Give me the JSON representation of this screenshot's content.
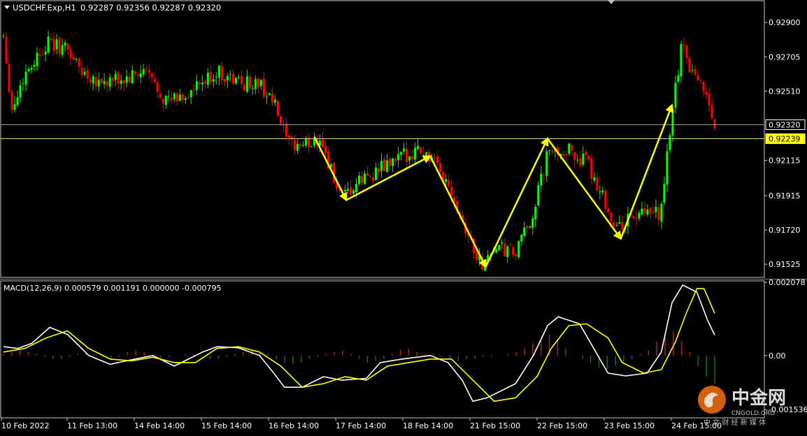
{
  "header": {
    "symbol": "USDCHF.Exp,H1",
    "ohlc": "0.92287 0.92356 0.92287 0.92320"
  },
  "macd": {
    "label": "MACD(12,26,9) 0.000579 0.001191 0.000000 -0.000795"
  },
  "watermark": {
    "brand": "中金网",
    "site": "CNGOLD.ORG",
    "tagline": "中 文 财 经 新 媒 体"
  },
  "colors": {
    "background": "#000000",
    "bull_candle": "#00ff00",
    "bear_candle": "#ff0000",
    "macd_line": "#ffffff",
    "signal_line": "#ffff00",
    "arrows": "#ffff00",
    "hist_positive": "#b02020",
    "hist_negative": "#1f6a1f",
    "current_price_tag": "#ffff00"
  },
  "chart_data": [
    {
      "type": "candlestick",
      "title": "USDCHF.Exp,H1",
      "y_ticks": [
        "0.92900",
        "0.92705",
        "0.92510",
        "0.92320",
        "0.92239",
        "0.92115",
        "0.91915",
        "0.91720",
        "0.91525"
      ],
      "ylim": [
        0.9145,
        0.9302
      ],
      "price_lines": [
        {
          "label": "0.92320",
          "value": 0.9232,
          "tag": "white"
        },
        {
          "label": "0.92239",
          "value": 0.92239,
          "tag": "yellow"
        }
      ],
      "x_ticks": [
        "10 Feb 2022",
        "11 Feb 13:00",
        "14 Feb 14:00",
        "15 Feb 14:00",
        "16 Feb 14:00",
        "17 Feb 14:00",
        "18 Feb 14:00",
        "21 Feb 15:00",
        "22 Feb 15:00",
        "23 Feb 15:00",
        "24 Feb 15:00"
      ],
      "close_path": [
        {
          "t": 0.0,
          "p": 0.9283
        },
        {
          "t": 0.012,
          "p": 0.924
        },
        {
          "t": 0.03,
          "p": 0.9261
        },
        {
          "t": 0.06,
          "p": 0.9278
        },
        {
          "t": 0.09,
          "p": 0.9275
        },
        {
          "t": 0.11,
          "p": 0.9262
        },
        {
          "t": 0.14,
          "p": 0.9256
        },
        {
          "t": 0.17,
          "p": 0.9257
        },
        {
          "t": 0.2,
          "p": 0.9262
        },
        {
          "t": 0.23,
          "p": 0.9245
        },
        {
          "t": 0.26,
          "p": 0.9249
        },
        {
          "t": 0.28,
          "p": 0.9255
        },
        {
          "t": 0.3,
          "p": 0.9262
        },
        {
          "t": 0.33,
          "p": 0.9256
        },
        {
          "t": 0.36,
          "p": 0.9255
        },
        {
          "t": 0.38,
          "p": 0.9244
        },
        {
          "t": 0.4,
          "p": 0.922
        },
        {
          "t": 0.43,
          "p": 0.9221
        },
        {
          "t": 0.445,
          "p": 0.9225
        },
        {
          "t": 0.475,
          "p": 0.9188
        },
        {
          "t": 0.505,
          "p": 0.9201
        },
        {
          "t": 0.55,
          "p": 0.9211
        },
        {
          "t": 0.585,
          "p": 0.9219
        },
        {
          "t": 0.605,
          "p": 0.921
        },
        {
          "t": 0.63,
          "p": 0.9195
        },
        {
          "t": 0.66,
          "p": 0.9162
        },
        {
          "t": 0.672,
          "p": 0.9152
        },
        {
          "t": 0.69,
          "p": 0.9162
        },
        {
          "t": 0.72,
          "p": 0.9158
        },
        {
          "t": 0.745,
          "p": 0.9182
        },
        {
          "t": 0.765,
          "p": 0.9215
        },
        {
          "t": 0.79,
          "p": 0.9218
        },
        {
          "t": 0.82,
          "p": 0.921
        },
        {
          "t": 0.845,
          "p": 0.919
        },
        {
          "t": 0.86,
          "p": 0.9172
        },
        {
          "t": 0.885,
          "p": 0.918
        },
        {
          "t": 0.91,
          "p": 0.918
        },
        {
          "t": 0.925,
          "p": 0.9182
        },
        {
          "t": 0.94,
          "p": 0.924
        },
        {
          "t": 0.955,
          "p": 0.928
        },
        {
          "t": 0.965,
          "p": 0.9265
        },
        {
          "t": 0.985,
          "p": 0.9253
        },
        {
          "t": 1.0,
          "p": 0.9232
        }
      ],
      "annotations": [
        {
          "type": "arrow",
          "from": {
            "t": 0.437,
            "p": 0.9225
          },
          "to": {
            "t": 0.482,
            "p": 0.9189
          }
        },
        {
          "type": "arrow",
          "from": {
            "t": 0.482,
            "p": 0.9189
          },
          "to": {
            "t": 0.6,
            "p": 0.9214
          }
        },
        {
          "type": "arrow",
          "from": {
            "t": 0.6,
            "p": 0.9214
          },
          "to": {
            "t": 0.678,
            "p": 0.9151
          }
        },
        {
          "type": "arrow",
          "from": {
            "t": 0.678,
            "p": 0.9151
          },
          "to": {
            "t": 0.765,
            "p": 0.9224
          }
        },
        {
          "type": "arrow",
          "from": {
            "t": 0.765,
            "p": 0.9224
          },
          "to": {
            "t": 0.868,
            "p": 0.9167
          }
        },
        {
          "type": "arrow",
          "from": {
            "t": 0.868,
            "p": 0.9167
          },
          "to": {
            "t": 0.94,
            "p": 0.9243
          }
        }
      ]
    },
    {
      "type": "line",
      "title": "MACD(12,26,9)",
      "y_ticks": [
        "0.002078",
        "0.00",
        "-0.001536"
      ],
      "ylim": [
        -0.00175,
        0.0021
      ],
      "series": [
        {
          "name": "MACD",
          "points": [
            {
              "t": 0.0,
              "v": 0.00025
            },
            {
              "t": 0.02,
              "v": 0.0002
            },
            {
              "t": 0.04,
              "v": 0.00035
            },
            {
              "t": 0.065,
              "v": 0.0008
            },
            {
              "t": 0.09,
              "v": 0.0006
            },
            {
              "t": 0.12,
              "v": 0.0
            },
            {
              "t": 0.15,
              "v": -0.00025
            },
            {
              "t": 0.18,
              "v": -0.00012
            },
            {
              "t": 0.21,
              "v": 0.0
            },
            {
              "t": 0.24,
              "v": -0.0003
            },
            {
              "t": 0.26,
              "v": -0.0001
            },
            {
              "t": 0.28,
              "v": 0.0001
            },
            {
              "t": 0.3,
              "v": 0.00025
            },
            {
              "t": 0.33,
              "v": 0.00022
            },
            {
              "t": 0.36,
              "v": 0.0
            },
            {
              "t": 0.38,
              "v": -0.0005
            },
            {
              "t": 0.395,
              "v": -0.0009
            },
            {
              "t": 0.42,
              "v": -0.0009
            },
            {
              "t": 0.45,
              "v": -0.0006
            },
            {
              "t": 0.475,
              "v": -0.0007
            },
            {
              "t": 0.51,
              "v": -0.00065
            },
            {
              "t": 0.53,
              "v": -0.0002
            },
            {
              "t": 0.56,
              "v": -0.0001
            },
            {
              "t": 0.6,
              "v": 0.0
            },
            {
              "t": 0.625,
              "v": -0.0002
            },
            {
              "t": 0.645,
              "v": -0.0007
            },
            {
              "t": 0.66,
              "v": -0.0013
            },
            {
              "t": 0.68,
              "v": -0.0012
            },
            {
              "t": 0.72,
              "v": -0.0008
            },
            {
              "t": 0.745,
              "v": 0.0
            },
            {
              "t": 0.765,
              "v": 0.00085
            },
            {
              "t": 0.78,
              "v": 0.0011
            },
            {
              "t": 0.81,
              "v": 0.0009
            },
            {
              "t": 0.83,
              "v": 0.0002
            },
            {
              "t": 0.85,
              "v": -0.0005
            },
            {
              "t": 0.875,
              "v": -0.00058
            },
            {
              "t": 0.905,
              "v": -0.0005
            },
            {
              "t": 0.925,
              "v": 0.0001
            },
            {
              "t": 0.94,
              "v": 0.0015
            },
            {
              "t": 0.955,
              "v": 0.002
            },
            {
              "t": 0.975,
              "v": 0.0018
            },
            {
              "t": 0.99,
              "v": 0.001
            },
            {
              "t": 1.0,
              "v": 0.00058
            }
          ]
        },
        {
          "name": "Signal",
          "points": [
            {
              "t": 0.0,
              "v": 0.0001
            },
            {
              "t": 0.03,
              "v": 0.0002
            },
            {
              "t": 0.06,
              "v": 0.0005
            },
            {
              "t": 0.09,
              "v": 0.0007
            },
            {
              "t": 0.12,
              "v": 0.0002
            },
            {
              "t": 0.15,
              "v": -0.0001
            },
            {
              "t": 0.18,
              "v": -0.00015
            },
            {
              "t": 0.21,
              "v": -5e-05
            },
            {
              "t": 0.24,
              "v": -0.0002
            },
            {
              "t": 0.27,
              "v": -0.0002
            },
            {
              "t": 0.3,
              "v": 0.0002
            },
            {
              "t": 0.33,
              "v": 0.00025
            },
            {
              "t": 0.36,
              "v": 0.0001
            },
            {
              "t": 0.39,
              "v": -0.0003
            },
            {
              "t": 0.42,
              "v": -0.0009
            },
            {
              "t": 0.45,
              "v": -0.0008
            },
            {
              "t": 0.48,
              "v": -0.0006
            },
            {
              "t": 0.51,
              "v": -0.0007
            },
            {
              "t": 0.54,
              "v": -0.0003
            },
            {
              "t": 0.57,
              "v": -0.0002
            },
            {
              "t": 0.6,
              "v": -0.0001
            },
            {
              "t": 0.63,
              "v": -0.0001
            },
            {
              "t": 0.66,
              "v": -0.0007
            },
            {
              "t": 0.69,
              "v": -0.0013
            },
            {
              "t": 0.72,
              "v": -0.0012
            },
            {
              "t": 0.75,
              "v": -0.0006
            },
            {
              "t": 0.77,
              "v": 0.0002
            },
            {
              "t": 0.795,
              "v": 0.00085
            },
            {
              "t": 0.82,
              "v": 0.0009
            },
            {
              "t": 0.85,
              "v": 0.0005
            },
            {
              "t": 0.87,
              "v": -0.0002
            },
            {
              "t": 0.9,
              "v": -0.0005
            },
            {
              "t": 0.925,
              "v": -0.0004
            },
            {
              "t": 0.945,
              "v": 0.0004
            },
            {
              "t": 0.96,
              "v": 0.0012
            },
            {
              "t": 0.975,
              "v": 0.0019
            },
            {
              "t": 0.985,
              "v": 0.0019
            },
            {
              "t": 1.0,
              "v": 0.0012
            }
          ]
        }
      ],
      "histogram": [
        5e-05,
        0.0001,
        0.00015,
        0.0001,
        5e-05,
        -5e-05,
        -0.0001,
        -0.0001,
        -5e-05,
        5e-05,
        0.0001,
        5e-05,
        -5e-05,
        -0.0001,
        -5e-05,
        0.0001,
        0.00015,
        0.0001,
        -5e-05,
        -0.0001,
        -5e-05,
        0.0,
        5e-05,
        5e-05,
        -5e-05,
        -0.0001,
        -0.0001,
        -5e-05,
        5e-05,
        0.0001,
        0.00015,
        0.0001,
        5e-05,
        -0.0001,
        -0.0002,
        -0.00025,
        -0.0002,
        -0.0001,
        -5e-05,
        5e-05,
        0.0001,
        0.00015,
        5e-05,
        -0.0001,
        -0.0002,
        -0.00015,
        -0.0001,
        5e-05,
        0.00015,
        0.0002,
        0.0001,
        5e-05,
        5e-05,
        -5e-05,
        -0.0001,
        -0.00015,
        -0.0001,
        -0.0001,
        -5e-05,
        -5e-05,
        0.0,
        5e-05,
        0.0001,
        0.0002,
        0.00035,
        0.0005,
        0.0006,
        0.00045,
        0.0002,
        0.0,
        -0.0001,
        -0.0002,
        -0.00035,
        -0.0004,
        -0.0003,
        -0.0002,
        -0.0001,
        5e-05,
        0.00015,
        0.0004,
        0.0006,
        0.0007,
        0.0004,
        0.0001,
        -0.0003,
        -0.0006,
        -0.0008
      ]
    }
  ]
}
